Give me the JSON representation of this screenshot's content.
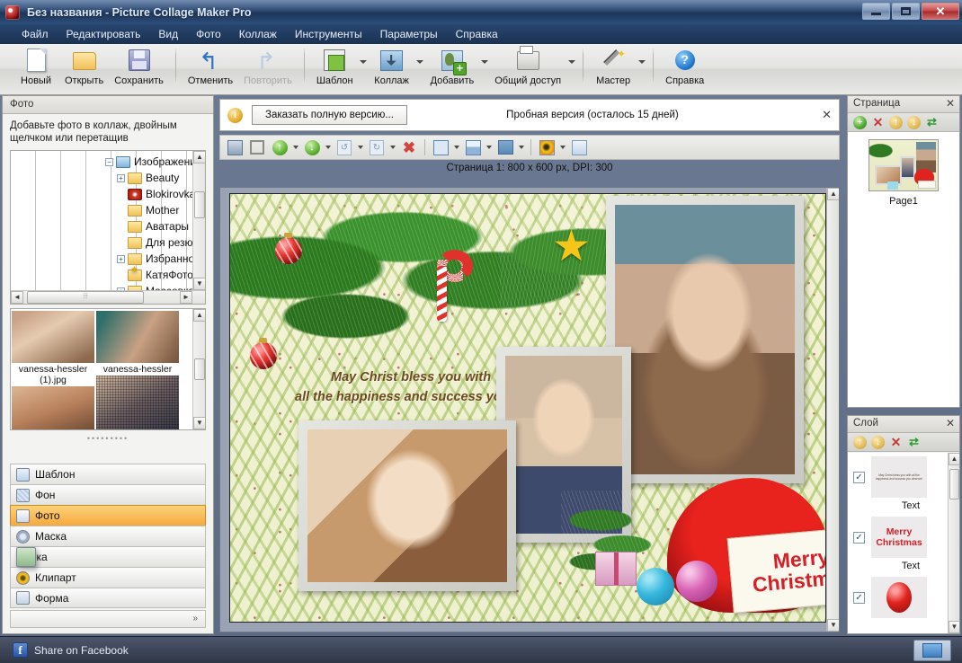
{
  "window": {
    "title": "Без названия - Picture Collage Maker Pro",
    "minimize_label": "—",
    "maximize_label": "□",
    "close_label": "✕"
  },
  "menubar": {
    "items": [
      {
        "label": "Файл"
      },
      {
        "label": "Редактировать"
      },
      {
        "label": "Вид"
      },
      {
        "label": "Фото"
      },
      {
        "label": "Коллаж"
      },
      {
        "label": "Инструменты"
      },
      {
        "label": "Параметры"
      },
      {
        "label": "Справка"
      }
    ]
  },
  "toolbar": {
    "buttons": [
      {
        "label": "Новый",
        "icon": "new-document-icon"
      },
      {
        "label": "Открыть",
        "icon": "open-folder-icon"
      },
      {
        "label": "Сохранить",
        "icon": "save-floppy-icon"
      },
      {
        "label": "Отменить",
        "icon": "undo-arrow-icon"
      },
      {
        "label": "Повторить",
        "icon": "redo-arrow-icon",
        "disabled": true
      },
      {
        "label": "Шаблон",
        "icon": "template-icon"
      },
      {
        "label": "Коллаж",
        "icon": "collage-icon"
      },
      {
        "label": "Добавить",
        "icon": "add-photo-icon"
      },
      {
        "label": "Общий доступ",
        "icon": "print-share-icon"
      },
      {
        "label": "Мастер",
        "icon": "wizard-wand-icon"
      },
      {
        "label": "Справка",
        "icon": "help-question-icon"
      }
    ]
  },
  "left_panel": {
    "header": "Фото",
    "hint": "Добавьте фото в коллаж, двойным щелчком или перетащив",
    "tree": [
      {
        "label": "Изображения",
        "indent": 0,
        "expander": "−",
        "icon": "picture-folder-icon"
      },
      {
        "label": "Beauty",
        "indent": 1,
        "expander": "+",
        "icon": "folder-icon"
      },
      {
        "label": "Blokirovka",
        "indent": 1,
        "expander": "",
        "icon": "red-disc-icon"
      },
      {
        "label": "Mother",
        "indent": 1,
        "expander": "",
        "icon": "folder-icon"
      },
      {
        "label": "Аватары",
        "indent": 1,
        "expander": "",
        "icon": "folder-icon"
      },
      {
        "label": "Для резюме",
        "indent": 1,
        "expander": "",
        "icon": "folder-icon"
      },
      {
        "label": "Избранное",
        "indent": 1,
        "expander": "+",
        "icon": "favorites-folder-icon"
      },
      {
        "label": "КатяФото",
        "indent": 1,
        "expander": "",
        "icon": "folder-icon"
      },
      {
        "label": "Массовка",
        "indent": 1,
        "expander": "+",
        "icon": "folder-icon"
      }
    ],
    "thumbnails": [
      {
        "caption": "vanessa-hessler (1).jpg"
      },
      {
        "caption": "vanessa-hessler"
      }
    ],
    "categories": [
      {
        "label": "Шаблон",
        "icon": "template-grid-icon",
        "selected": false
      },
      {
        "label": "Фон",
        "icon": "background-icon",
        "selected": false
      },
      {
        "label": "Фото",
        "icon": "photo-icon",
        "selected": true
      },
      {
        "label": "Маска",
        "icon": "mask-icon",
        "selected": false
      },
      {
        "label": "Рамка",
        "icon": "frame-icon",
        "selected": false
      },
      {
        "label": "Клипарт",
        "icon": "clipart-icon",
        "selected": false
      },
      {
        "label": "Форма",
        "icon": "shape-icon",
        "selected": false
      }
    ],
    "expand_label": "»"
  },
  "trial": {
    "order_button": "Заказать полную версию...",
    "status": "Пробная версия (осталось 15 дней)",
    "close_label": "✕",
    "info_icon": "info-icon"
  },
  "canvas_toolbar": {
    "buttons": [
      {
        "icon": "portrait-icon"
      },
      {
        "icon": "crop-icon"
      },
      {
        "icon": "move-up-icon",
        "dropdown": true
      },
      {
        "icon": "move-down-icon",
        "dropdown": true
      },
      {
        "icon": "rotate-left-icon",
        "dropdown": true
      },
      {
        "icon": "rotate-right-icon",
        "dropdown": true
      },
      {
        "icon": "delete-red-x-icon"
      },
      {
        "icon": "align-vertical-icon",
        "dropdown": true
      },
      {
        "icon": "align-left-icon",
        "dropdown": true
      },
      {
        "icon": "distribute-icon",
        "dropdown": true
      },
      {
        "icon": "effects-icon",
        "dropdown": true
      },
      {
        "icon": "properties-icon"
      }
    ]
  },
  "page_info": "Страница 1: 800 x 600 px, DPI: 300",
  "collage": {
    "greeting_line1": "May Christ bless you with",
    "greeting_line2": "all the happiness and success you deserve!",
    "sign_line1": "Merry",
    "sign_line2": "Christmas"
  },
  "page_panel": {
    "header": "Страница",
    "close_label": "✕",
    "tools": [
      {
        "icon": "add-page-icon"
      },
      {
        "icon": "delete-page-icon"
      },
      {
        "icon": "move-page-up-icon"
      },
      {
        "icon": "move-page-down-icon"
      },
      {
        "icon": "refresh-icon"
      }
    ],
    "pages": [
      {
        "label": "Page1"
      }
    ]
  },
  "layer_panel": {
    "header": "Слой",
    "close_label": "✕",
    "tools": [
      {
        "icon": "layer-up-icon"
      },
      {
        "icon": "layer-down-icon"
      },
      {
        "icon": "delete-layer-icon"
      },
      {
        "icon": "refresh-layers-icon"
      }
    ],
    "layers": [
      {
        "label": "Text",
        "preview_text": "May Christ bless you with all the happiness and success you deserve!",
        "checked": true
      },
      {
        "label": "Text",
        "preview_text": "Merry Christmas",
        "checked": true
      },
      {
        "label": "",
        "preview_text": "",
        "checked": true
      }
    ]
  },
  "statusbar": {
    "facebook_label": "Share on Facebook",
    "facebook_icon": "facebook-icon",
    "monitor_icon": "display-icon"
  },
  "colors": {
    "title_bar": "#27456e",
    "accent_selected": "#f6a93c",
    "canvas_bg": "#9aa3b3",
    "christmas_red": "#d61f26"
  }
}
